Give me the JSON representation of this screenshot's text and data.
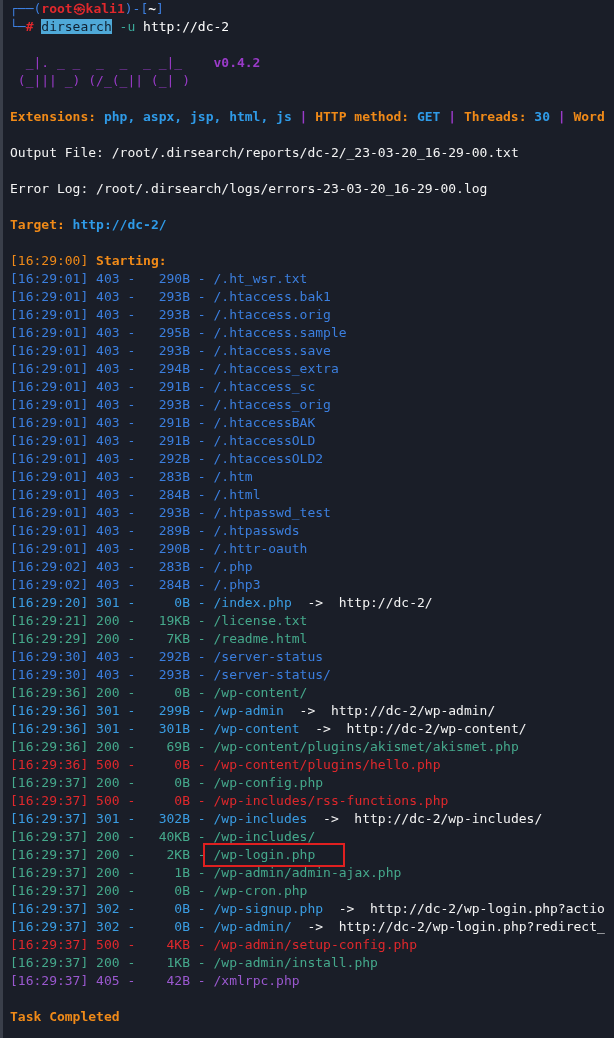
{
  "prompt": {
    "line_1": [
      {
        "text": "┌──(",
        "kind": "frame"
      },
      {
        "text": "root㉿kali1",
        "kind": "user"
      },
      {
        "text": ")-[",
        "kind": "frame"
      },
      {
        "text": "~",
        "kind": "cwd"
      },
      {
        "text": "]",
        "kind": "frame"
      }
    ],
    "line_2": [
      {
        "text": "└─",
        "kind": "frame"
      },
      {
        "text": "#",
        "kind": "user"
      },
      {
        "text": "dirsearch",
        "kind": "selection"
      },
      {
        "text": "-u",
        "kind": "option"
      },
      {
        "text": "http://dc-2",
        "kind": "plain"
      }
    ]
  },
  "banner": {
    "art": [
      "_|. _ _  _  _  _ _|_",
      "(_||| _) (/_(_|| (_| )"
    ],
    "version": "v0.4.2"
  },
  "config": {
    "separator": "|",
    "items": [
      {
        "label": "Extensions:",
        "value": "php, aspx, jsp, html, js"
      },
      {
        "label": "HTTP method:",
        "value": "GET"
      },
      {
        "label": "Threads:",
        "value": "30"
      },
      {
        "label": "Word"
      }
    ]
  },
  "output_file": {
    "label": "Output File:",
    "value": "/root/.dirsearch/reports/dc-2/_23-03-20_16-29-00.txt"
  },
  "error_log": {
    "label": "Error Log:",
    "value": "/root/.dirsearch/logs/errors-23-03-20_16-29-00.log"
  },
  "target": {
    "label": "Target:",
    "value": "http://dc-2/"
  },
  "start": {
    "time": "[16:29:00]",
    "label": "Starting:"
  },
  "results": {
    "separator": "-",
    "rows": [
      {
        "time": "[16:29:01]",
        "status": "403",
        "size": "290B",
        "path": "/.ht_wsr.txt",
        "color": "#3b7fdf",
        "highlighted": false
      },
      {
        "time": "[16:29:01]",
        "status": "403",
        "size": "293B",
        "path": "/.htaccess.bak1",
        "color": "#3b7fdf",
        "highlighted": false
      },
      {
        "time": "[16:29:01]",
        "status": "403",
        "size": "293B",
        "path": "/.htaccess.orig",
        "color": "#3b7fdf",
        "highlighted": false
      },
      {
        "time": "[16:29:01]",
        "status": "403",
        "size": "295B",
        "path": "/.htaccess.sample",
        "color": "#3b7fdf",
        "highlighted": false
      },
      {
        "time": "[16:29:01]",
        "status": "403",
        "size": "293B",
        "path": "/.htaccess.save",
        "color": "#3b7fdf",
        "highlighted": false
      },
      {
        "time": "[16:29:01]",
        "status": "403",
        "size": "294B",
        "path": "/.htaccess_extra",
        "color": "#3b7fdf",
        "highlighted": false
      },
      {
        "time": "[16:29:01]",
        "status": "403",
        "size": "291B",
        "path": "/.htaccess_sc",
        "color": "#3b7fdf",
        "highlighted": false
      },
      {
        "time": "[16:29:01]",
        "status": "403",
        "size": "293B",
        "path": "/.htaccess_orig",
        "color": "#3b7fdf",
        "highlighted": false
      },
      {
        "time": "[16:29:01]",
        "status": "403",
        "size": "291B",
        "path": "/.htaccessBAK",
        "color": "#3b7fdf",
        "highlighted": false
      },
      {
        "time": "[16:29:01]",
        "status": "403",
        "size": "291B",
        "path": "/.htaccessOLD",
        "color": "#3b7fdf",
        "highlighted": false
      },
      {
        "time": "[16:29:01]",
        "status": "403",
        "size": "292B",
        "path": "/.htaccessOLD2",
        "color": "#3b7fdf",
        "highlighted": false
      },
      {
        "time": "[16:29:01]",
        "status": "403",
        "size": "283B",
        "path": "/.htm",
        "color": "#3b7fdf",
        "highlighted": false
      },
      {
        "time": "[16:29:01]",
        "status": "403",
        "size": "284B",
        "path": "/.html",
        "color": "#3b7fdf",
        "highlighted": false
      },
      {
        "time": "[16:29:01]",
        "status": "403",
        "size": "293B",
        "path": "/.htpasswd_test",
        "color": "#3b7fdf",
        "highlighted": false
      },
      {
        "time": "[16:29:01]",
        "status": "403",
        "size": "289B",
        "path": "/.htpasswds",
        "color": "#3b7fdf",
        "highlighted": false
      },
      {
        "time": "[16:29:01]",
        "status": "403",
        "size": "290B",
        "path": "/.httr-oauth",
        "color": "#3b7fdf",
        "highlighted": false
      },
      {
        "time": "[16:29:02]",
        "status": "403",
        "size": "283B",
        "path": "/.php",
        "color": "#3b7fdf",
        "highlighted": false
      },
      {
        "time": "[16:29:02]",
        "status": "403",
        "size": "284B",
        "path": "/.php3",
        "color": "#3b7fdf",
        "highlighted": false
      },
      {
        "time": "[16:29:20]",
        "status": "301",
        "size": "0B",
        "path": "/index.php",
        "redirect": "->  http://dc-2/",
        "color": "#3a9de3",
        "highlighted": false
      },
      {
        "time": "[16:29:21]",
        "status": "200",
        "size": "19KB",
        "path": "/license.txt",
        "color": "#45a98c",
        "highlighted": false
      },
      {
        "time": "[16:29:29]",
        "status": "200",
        "size": "7KB",
        "path": "/readme.html",
        "color": "#45a98c",
        "highlighted": false
      },
      {
        "time": "[16:29:30]",
        "status": "403",
        "size": "292B",
        "path": "/server-status",
        "color": "#3b7fdf",
        "highlighted": false
      },
      {
        "time": "[16:29:30]",
        "status": "403",
        "size": "293B",
        "path": "/server-status/",
        "color": "#3b7fdf",
        "highlighted": false
      },
      {
        "time": "[16:29:36]",
        "status": "200",
        "size": "0B",
        "path": "/wp-content/",
        "color": "#45a98c",
        "highlighted": false
      },
      {
        "time": "[16:29:36]",
        "status": "301",
        "size": "299B",
        "path": "/wp-admin",
        "redirect": "->  http://dc-2/wp-admin/",
        "color": "#3a9de3",
        "highlighted": false
      },
      {
        "time": "[16:29:36]",
        "status": "301",
        "size": "301B",
        "path": "/wp-content",
        "redirect": "->  http://dc-2/wp-content/",
        "color": "#3a9de3",
        "highlighted": false
      },
      {
        "time": "[16:29:36]",
        "status": "200",
        "size": "69B",
        "path": "/wp-content/plugins/akismet/akismet.php",
        "color": "#45a98c",
        "highlighted": false
      },
      {
        "time": "[16:29:36]",
        "status": "500",
        "size": "0B",
        "path": "/wp-content/plugins/hello.php",
        "color": "#e0282c",
        "highlighted": false
      },
      {
        "time": "[16:29:37]",
        "status": "200",
        "size": "0B",
        "path": "/wp-config.php",
        "color": "#45a98c",
        "highlighted": false
      },
      {
        "time": "[16:29:37]",
        "status": "500",
        "size": "0B",
        "path": "/wp-includes/rss-functions.php",
        "color": "#e0282c",
        "highlighted": false
      },
      {
        "time": "[16:29:37]",
        "status": "301",
        "size": "302B",
        "path": "/wp-includes",
        "redirect": "->  http://dc-2/wp-includes/",
        "color": "#3a9de3",
        "highlighted": false
      },
      {
        "time": "[16:29:37]",
        "status": "200",
        "size": "40KB",
        "path": "/wp-includes/",
        "color": "#45a98c",
        "highlighted": false
      },
      {
        "time": "[16:29:37]",
        "status": "200",
        "size": "2KB",
        "path": "/wp-login.php",
        "color": "#45a98c",
        "highlighted": true
      },
      {
        "time": "[16:29:37]",
        "status": "200",
        "size": "1B",
        "path": "/wp-admin/admin-ajax.php",
        "color": "#45a98c",
        "highlighted": false
      },
      {
        "time": "[16:29:37]",
        "status": "200",
        "size": "0B",
        "path": "/wp-cron.php",
        "color": "#45a98c",
        "highlighted": false
      },
      {
        "time": "[16:29:37]",
        "status": "302",
        "size": "0B",
        "path": "/wp-signup.php",
        "redirect": "->  http://dc-2/wp-login.php?actio",
        "color": "#3a9de3",
        "highlighted": false
      },
      {
        "time": "[16:29:37]",
        "status": "302",
        "size": "0B",
        "path": "/wp-admin/",
        "redirect": "->  http://dc-2/wp-login.php?redirect_",
        "color": "#3a9de3",
        "highlighted": false
      },
      {
        "time": "[16:29:37]",
        "status": "500",
        "size": "4KB",
        "path": "/wp-admin/setup-config.php",
        "color": "#e0282c",
        "highlighted": false
      },
      {
        "time": "[16:29:37]",
        "status": "200",
        "size": "1KB",
        "path": "/wp-admin/install.php",
        "color": "#45a98c",
        "highlighted": false
      },
      {
        "time": "[16:29:37]",
        "status": "405",
        "size": "42B",
        "path": "/xmlrpc.php",
        "color": "#9a58cf",
        "highlighted": false
      }
    ]
  },
  "done": "Task Completed"
}
